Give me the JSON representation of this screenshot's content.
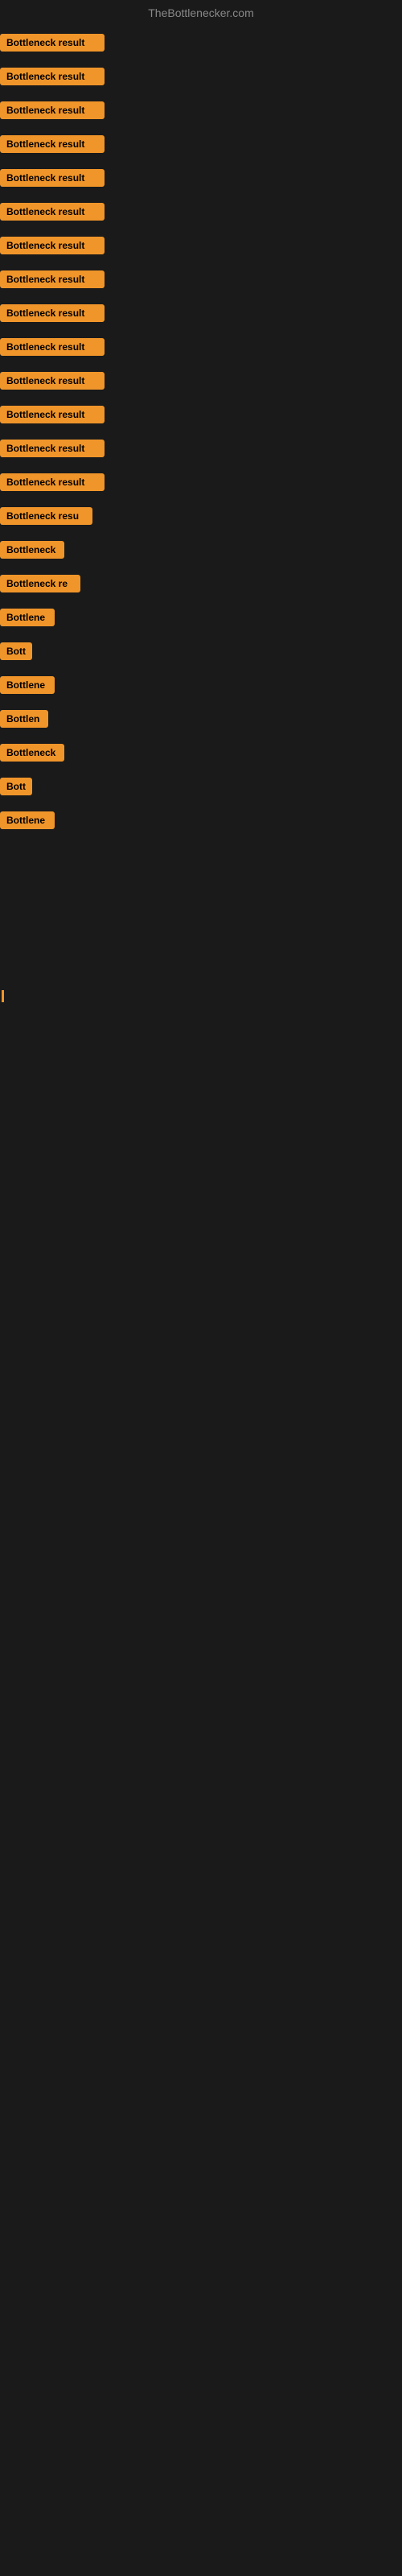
{
  "site": {
    "title": "TheBottlenecker.com"
  },
  "items": [
    {
      "id": 1,
      "label": "Bottleneck result",
      "width": 130
    },
    {
      "id": 2,
      "label": "Bottleneck result",
      "width": 130
    },
    {
      "id": 3,
      "label": "Bottleneck result",
      "width": 130
    },
    {
      "id": 4,
      "label": "Bottleneck result",
      "width": 130
    },
    {
      "id": 5,
      "label": "Bottleneck result",
      "width": 130
    },
    {
      "id": 6,
      "label": "Bottleneck result",
      "width": 130
    },
    {
      "id": 7,
      "label": "Bottleneck result",
      "width": 130
    },
    {
      "id": 8,
      "label": "Bottleneck result",
      "width": 130
    },
    {
      "id": 9,
      "label": "Bottleneck result",
      "width": 130
    },
    {
      "id": 10,
      "label": "Bottleneck result",
      "width": 130
    },
    {
      "id": 11,
      "label": "Bottleneck result",
      "width": 130
    },
    {
      "id": 12,
      "label": "Bottleneck result",
      "width": 130
    },
    {
      "id": 13,
      "label": "Bottleneck result",
      "width": 130
    },
    {
      "id": 14,
      "label": "Bottleneck result",
      "width": 130
    },
    {
      "id": 15,
      "label": "Bottleneck resu",
      "width": 115
    },
    {
      "id": 16,
      "label": "Bottleneck",
      "width": 80
    },
    {
      "id": 17,
      "label": "Bottleneck re",
      "width": 100
    },
    {
      "id": 18,
      "label": "Bottlene",
      "width": 68
    },
    {
      "id": 19,
      "label": "Bott",
      "width": 40
    },
    {
      "id": 20,
      "label": "Bottlene",
      "width": 68
    },
    {
      "id": 21,
      "label": "Bottlen",
      "width": 60
    },
    {
      "id": 22,
      "label": "Bottleneck",
      "width": 80
    },
    {
      "id": 23,
      "label": "Bott",
      "width": 40
    },
    {
      "id": 24,
      "label": "Bottlene",
      "width": 68
    }
  ],
  "colors": {
    "badge_bg": "#f0952a",
    "background": "#1a1a1a",
    "title_color": "#888888"
  }
}
